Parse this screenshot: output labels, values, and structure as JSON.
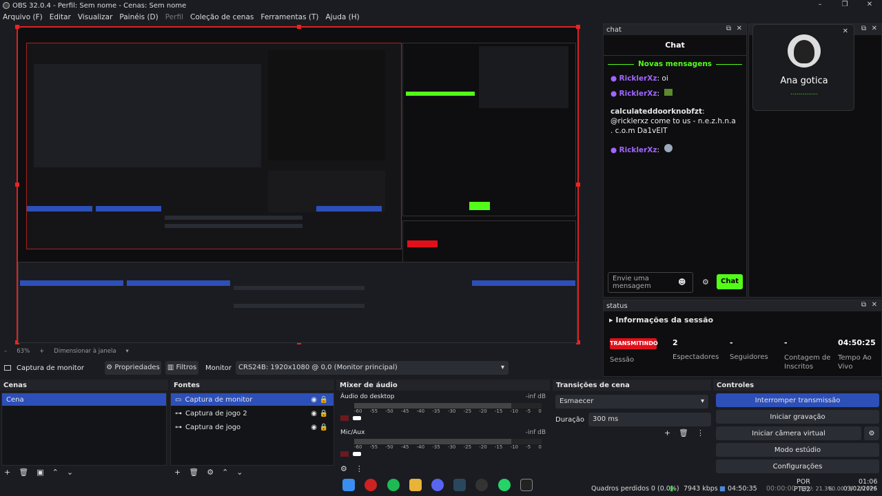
{
  "window": {
    "title": "OBS 32.0.4 - Perfil: Sem nome - Cenas: Sem nome",
    "controls": [
      "–",
      "❐",
      "✕"
    ]
  },
  "menu": [
    "Arquivo (F)",
    "Editar",
    "Visualizar",
    "Painéis (D)",
    "Perfil",
    "Coleção de cenas",
    "Ferramentas (T)",
    "Ajuda (H)"
  ],
  "chat_dock": {
    "tab": "chat",
    "title": "Chat",
    "new_messages": "Novas mensagens",
    "messages": [
      {
        "user": "RicklerXz",
        "text": ": oi"
      },
      {
        "user": "RicklerXz",
        "text": ":"
      },
      {
        "user": "calculateddoorknobfzt",
        "text": ": @ricklerxz come to us - n.e.z.h.n.a . c.o.m Da1vEIT"
      },
      {
        "user": "RicklerXz",
        "text": ":"
      }
    ],
    "input_placeholder": "Envie uma mensagem",
    "send_label": "Chat"
  },
  "profile_card": {
    "name": "Ana gotica",
    "dots": "..............",
    "close": "✕"
  },
  "status_dock": {
    "tab": "status",
    "header": "Informações da sessão",
    "badge": "TRANSMITINDO",
    "session_label": "Sessão",
    "stats": [
      {
        "value": "2",
        "label": "Espectadores"
      },
      {
        "value": "-",
        "label": "Seguidores"
      },
      {
        "value": "-",
        "label": "Contagem de Inscritos"
      },
      {
        "value": "04:50:25",
        "label": "Tempo Ao Vivo"
      }
    ]
  },
  "zoom": {
    "level": "63%",
    "mode": "Dimensionar à janela"
  },
  "propbar": {
    "source": "Captura de monitor",
    "properties": "Propriedades",
    "filters": "Filtros",
    "monitor_label": "Monitor",
    "monitor_value": "CRS24B: 1920x1080 @ 0,0 (Monitor principal)"
  },
  "scenes": {
    "title": "Cenas",
    "items": [
      "Cena"
    ]
  },
  "sources": {
    "title": "Fontes",
    "items": [
      "Captura de monitor",
      "Captura de jogo 2",
      "Captura de jogo"
    ]
  },
  "mixer": {
    "title": "Mixer de áudio",
    "channels": [
      {
        "name": "Áudio do desktop",
        "level": "-inf dB"
      },
      {
        "name": "Mic/Aux",
        "level": "-inf dB"
      }
    ],
    "ticks": [
      "-60",
      "-55",
      "-50",
      "-45",
      "-40",
      "-35",
      "-30",
      "-25",
      "-20",
      "-15",
      "-10",
      "-5",
      "0"
    ]
  },
  "transitions": {
    "title": "Transições de cena",
    "selected": "Esmaecer",
    "duration_label": "Duração",
    "duration_value": "300 ms"
  },
  "controls": {
    "title": "Controles",
    "buttons": [
      "Interromper transmissão",
      "Iniciar gravação",
      "Iniciar câmera virtual",
      "Modo estúdio",
      "Configurações"
    ]
  },
  "status": {
    "dropped": "Quadros perdidos 0 (0.0%)",
    "bitrate": "7943 kbps",
    "stream_time": "04:50:35",
    "rec_time": "00:00:00",
    "cpu": "CPU: 21.3%",
    "fps": "60.00 / 60.00 FPS",
    "lang": "POR",
    "lang2": "PTB2",
    "clock": "01:06",
    "date": "03/02/2026"
  },
  "colors": {
    "accent": "#2d4fb8",
    "live": "#e0101b",
    "kick_green": "#53fc18",
    "user_purple": "#a066ff"
  }
}
